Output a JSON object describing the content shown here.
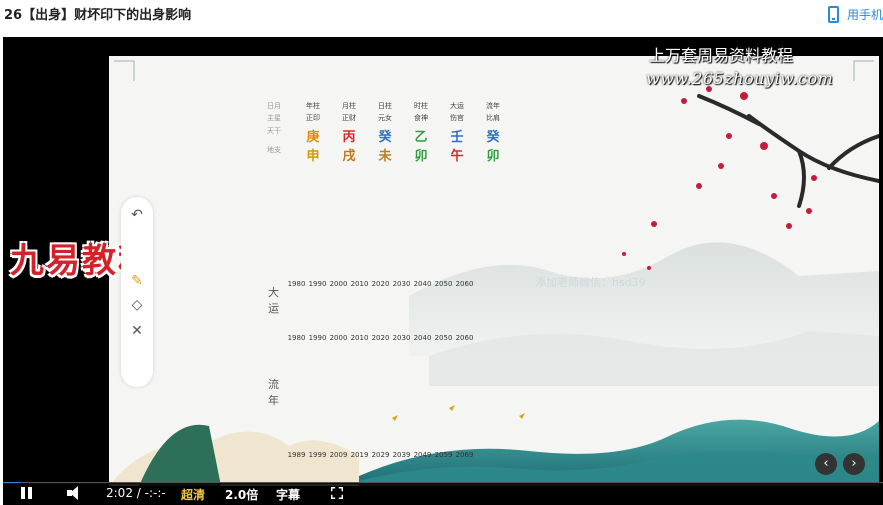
{
  "header": {
    "title": "26【出身】财坏印下的出身影响",
    "mobile_link": "用手机",
    "icon": "phone-icon"
  },
  "slide": {
    "watermark_title": "上万套周易资料教程",
    "watermark_url": "www.265zhouyiw.com",
    "wechat": "添加老师微信：hsd39",
    "logo": "九易教程",
    "chart": {
      "labels": [
        "日月",
        "主星",
        "天干",
        "地支"
      ],
      "pillars": [
        {
          "col": "年柱",
          "star": "正印",
          "gan": "庚",
          "zhi": "申",
          "gan_color": "#e08b00",
          "zhi_color": "#d69a00"
        },
        {
          "col": "月柱",
          "star": "正财",
          "gan": "丙",
          "zhi": "戌",
          "gan_color": "#d62a2a",
          "zhi_color": "#c0791f"
        },
        {
          "col": "日柱",
          "star": "元女",
          "gan": "癸",
          "zhi": "未",
          "gan_color": "#2f6fc6",
          "zhi_color": "#c0791f"
        },
        {
          "col": "时柱",
          "star": "食神",
          "gan": "乙",
          "zhi": "卯",
          "gan_color": "#2e9f3c",
          "zhi_color": "#2e9f3c"
        },
        {
          "col": "大运",
          "star": "伤官",
          "gan": "壬",
          "zhi": "午",
          "gan_color": "#2f6fc6",
          "zhi_color": "#d62a2a"
        },
        {
          "col": "流年",
          "star": "比肩",
          "gan": "癸",
          "zhi": "卯",
          "gan_color": "#2f6fc6",
          "zhi_color": "#2e9f3c"
        }
      ],
      "dayun_label": "大运",
      "liunian_label": "流年",
      "dayun_years": [
        "1980",
        "1990",
        "2000",
        "2010",
        "2020",
        "2030",
        "2040",
        "2050",
        "2060"
      ],
      "liunian_years": [
        "1980",
        "1990",
        "2000",
        "2010",
        "2020",
        "2030",
        "2040",
        "2050",
        "2060"
      ],
      "end_years": [
        "1989",
        "1999",
        "2009",
        "2019",
        "2029",
        "2039",
        "2049",
        "2059",
        "2069"
      ]
    }
  },
  "toolbar": {
    "undo_icon": "undo-icon",
    "pen_icon": "pen-icon",
    "eraser_icon": "eraser-icon",
    "close_icon": "close-icon"
  },
  "controls": {
    "time": "2:02 / -:-:-",
    "quality": "超清",
    "speed": "2.0倍",
    "subtitles": "字幕",
    "progress": 0.02
  }
}
